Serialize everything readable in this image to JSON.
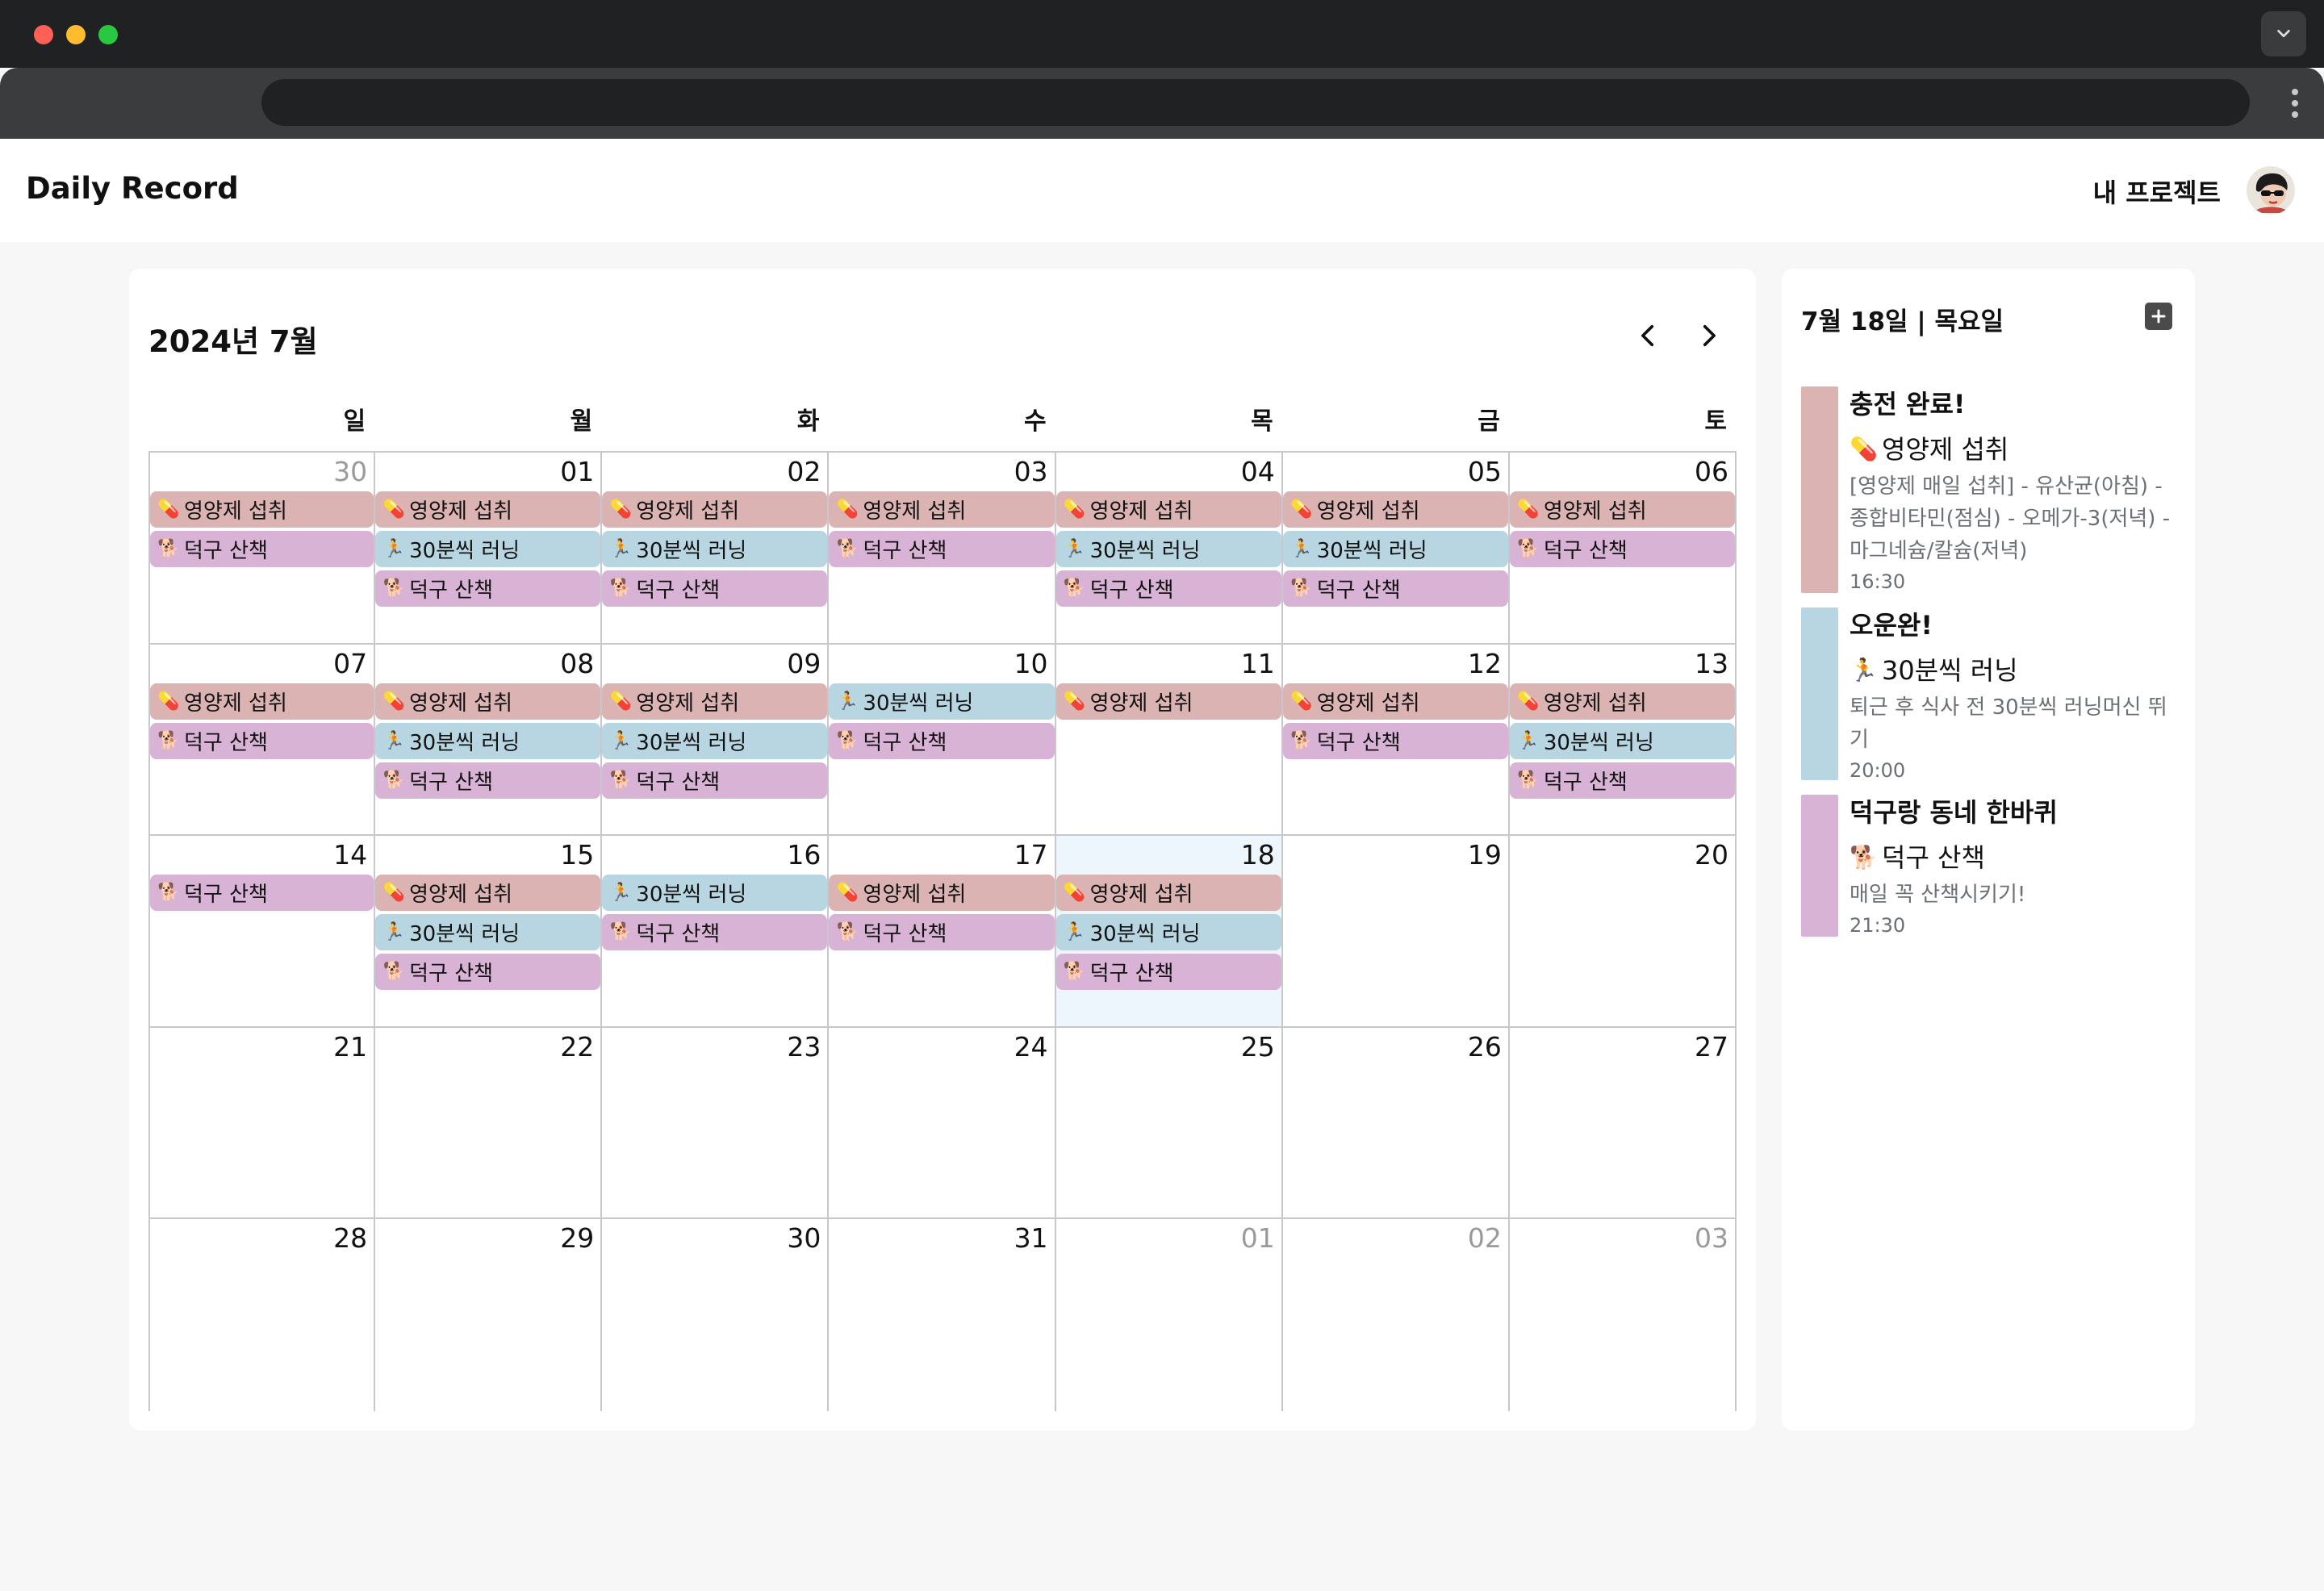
{
  "app": {
    "title": "Daily Record",
    "project_link": "내 프로젝트"
  },
  "colors": {
    "supplement": "#dbb3b2",
    "running": "#b7d6e1",
    "walk": "#d8b3d6",
    "today_highlight": "#edf5fd"
  },
  "event_types": {
    "supplement": {
      "label": "영양제 섭취",
      "icon": "💊",
      "icon_name": "pill-icon"
    },
    "running": {
      "label": "30분씩 러닝",
      "icon": "🏃",
      "icon_name": "runner-icon"
    },
    "walk": {
      "label": "덕구 산책",
      "icon": "🐕",
      "icon_name": "dog-icon"
    }
  },
  "calendar": {
    "month_title": "2024년 7월",
    "weekdays": [
      "일",
      "월",
      "화",
      "수",
      "목",
      "금",
      "토"
    ],
    "days": [
      {
        "day": "30",
        "other": true,
        "events": [
          "supplement",
          "walk"
        ]
      },
      {
        "day": "01",
        "events": [
          "supplement",
          "running",
          "walk"
        ]
      },
      {
        "day": "02",
        "events": [
          "supplement",
          "running",
          "walk"
        ]
      },
      {
        "day": "03",
        "events": [
          "supplement",
          "walk"
        ]
      },
      {
        "day": "04",
        "events": [
          "supplement",
          "running",
          "walk"
        ]
      },
      {
        "day": "05",
        "events": [
          "supplement",
          "running",
          "walk"
        ]
      },
      {
        "day": "06",
        "events": [
          "supplement",
          "walk"
        ]
      },
      {
        "day": "07",
        "events": [
          "supplement",
          "walk"
        ]
      },
      {
        "day": "08",
        "events": [
          "supplement",
          "running",
          "walk"
        ]
      },
      {
        "day": "09",
        "events": [
          "supplement",
          "running",
          "walk"
        ]
      },
      {
        "day": "10",
        "events": [
          "running",
          "walk"
        ]
      },
      {
        "day": "11",
        "events": [
          "supplement"
        ]
      },
      {
        "day": "12",
        "events": [
          "supplement",
          "walk"
        ]
      },
      {
        "day": "13",
        "events": [
          "supplement",
          "running",
          "walk"
        ]
      },
      {
        "day": "14",
        "events": [
          "walk"
        ]
      },
      {
        "day": "15",
        "events": [
          "supplement",
          "running",
          "walk"
        ]
      },
      {
        "day": "16",
        "events": [
          "running",
          "walk"
        ]
      },
      {
        "day": "17",
        "events": [
          "supplement",
          "walk"
        ]
      },
      {
        "day": "18",
        "today": true,
        "events": [
          "supplement",
          "running",
          "walk"
        ]
      },
      {
        "day": "19",
        "events": []
      },
      {
        "day": "20",
        "events": []
      },
      {
        "day": "21",
        "events": []
      },
      {
        "day": "22",
        "events": []
      },
      {
        "day": "23",
        "events": []
      },
      {
        "day": "24",
        "events": []
      },
      {
        "day": "25",
        "events": []
      },
      {
        "day": "26",
        "events": []
      },
      {
        "day": "27",
        "events": []
      },
      {
        "day": "28",
        "events": []
      },
      {
        "day": "29",
        "events": []
      },
      {
        "day": "30",
        "events": []
      },
      {
        "day": "31",
        "events": []
      },
      {
        "day": "01",
        "other": true,
        "events": []
      },
      {
        "day": "02",
        "other": true,
        "events": []
      },
      {
        "day": "03",
        "other": true,
        "events": []
      }
    ]
  },
  "detail": {
    "date_label": "7월 18일 | 목요일",
    "entries": [
      {
        "type": "supplement",
        "title": "충전 완료!",
        "subtitle": "영양제 섭취",
        "description": "[영양제 매일 섭취] - 유산균(아침) - 종합비타민(점심) - 오메가-3(저녁) - 마그네슘/칼슘(저녁)",
        "time": "16:30"
      },
      {
        "type": "running",
        "title": "오운완!",
        "subtitle": "30분씩 러닝",
        "description": "퇴근 후 식사 전 30분씩 러닝머신 뛰기",
        "time": "20:00"
      },
      {
        "type": "walk",
        "title": "덕구랑 동네 한바퀴",
        "subtitle": "덕구 산책",
        "description": "매일 꼭 산책시키기!",
        "time": "21:30"
      }
    ]
  }
}
